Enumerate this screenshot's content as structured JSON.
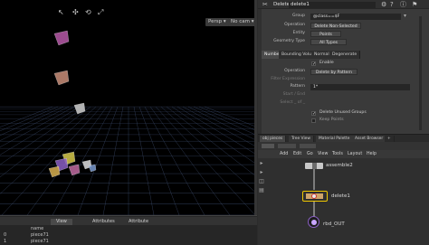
{
  "viewport": {
    "persp_label": "Persp",
    "cam_label": "No cam",
    "icons": [
      "select-icon",
      "move-icon",
      "rotate-icon",
      "scale-icon",
      "handle-icon",
      "snap-icon"
    ]
  },
  "spreadsheet": {
    "tabs": [
      "View",
      "Attributes",
      "Attribute"
    ],
    "column_header": "name",
    "rows": [
      {
        "index": "0",
        "name": "piece71"
      },
      {
        "index": "1",
        "name": "piece71"
      },
      {
        "index": "2",
        "name": "piece71"
      }
    ]
  },
  "parameters": {
    "node_type": "Delete",
    "node_name": "delete1",
    "group_label": "Group",
    "group_value": "@class==$F",
    "operation_label": "Operation",
    "operation_value": "Delete Non-Selected",
    "entity_label": "Entity",
    "entity_value": "Points",
    "geometry_type_label": "Geometry Type",
    "geometry_type_value": "All Types",
    "tabs": [
      "Number",
      "Bounding Volume",
      "Normal",
      "Degenerate"
    ],
    "enable_label": "Enable",
    "number_operation_label": "Operation",
    "number_operation_value": "Delete by Pattern",
    "filter_expression_label": "Filter Expression",
    "pattern_label": "Pattern",
    "pattern_value": "1*",
    "start_end_label": "Start / End",
    "select_label": "Select _ of _",
    "delete_unused_label": "Delete Unused Groups",
    "keep_points_label": "Keep Points"
  },
  "network": {
    "tabs": [
      "obj pieces",
      "Tree View",
      "Material Palette",
      "Asset Browser"
    ],
    "menu": [
      "Add",
      "Edit",
      "Go",
      "View",
      "Tools",
      "Layout",
      "Help"
    ],
    "nodes": {
      "assemble": "assemble2",
      "delete": "delete1",
      "output": "rbd_OUT"
    }
  },
  "colors": {
    "viewport_bg": "#000000",
    "grid_line": "#3b4a6a",
    "panel_bg": "#3a3a3a",
    "node_selected": "#f0c800",
    "node_body": "#c8c8c8"
  }
}
